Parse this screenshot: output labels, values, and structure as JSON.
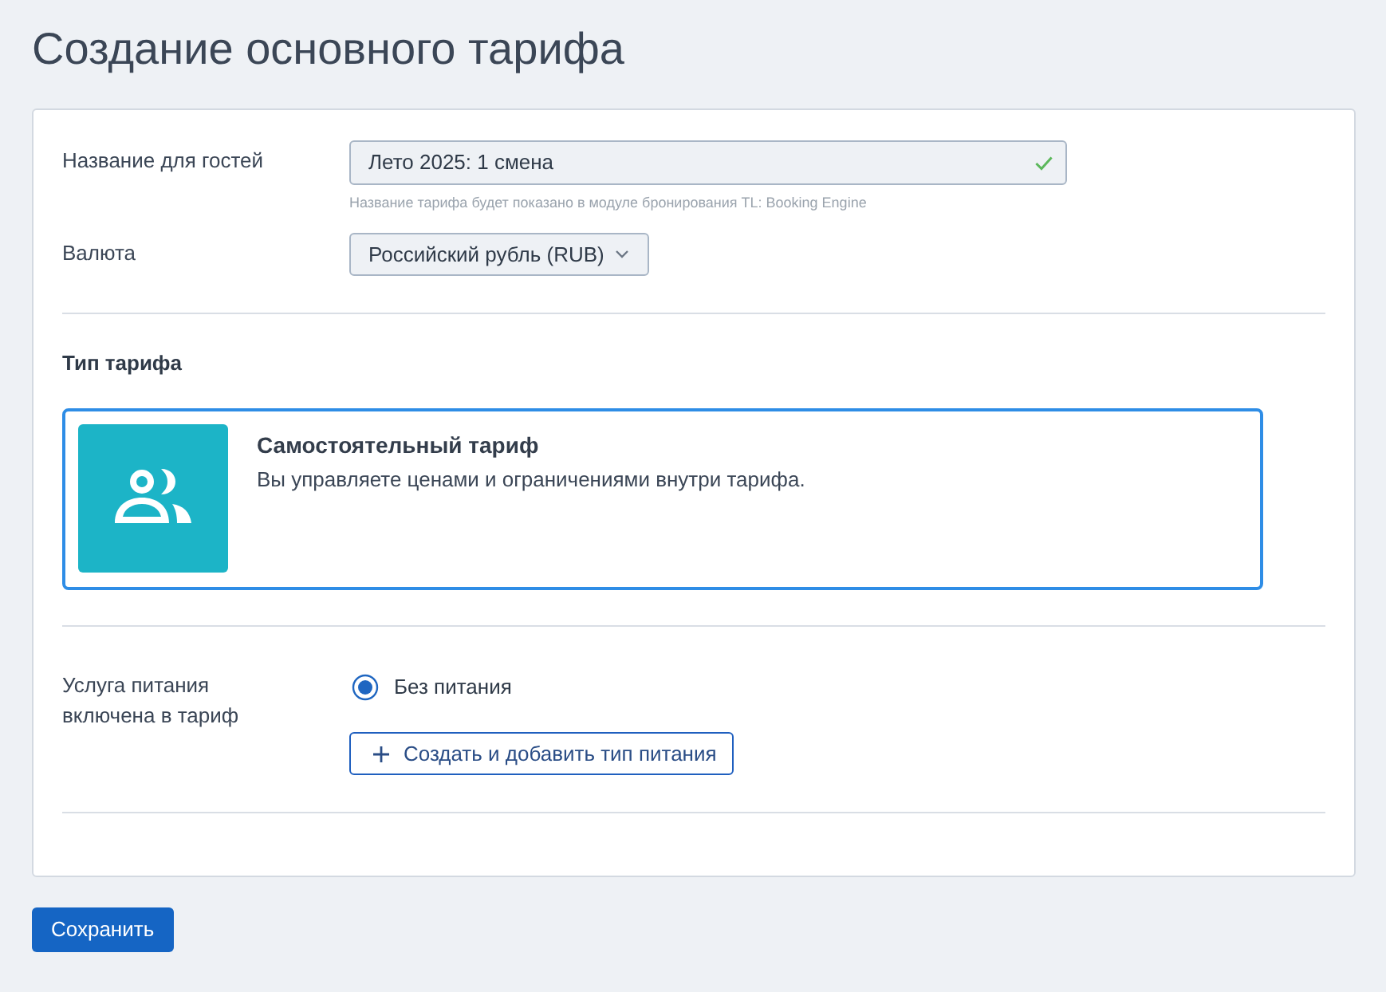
{
  "page": {
    "title": "Создание основного тарифа"
  },
  "form": {
    "guest_name": {
      "label": "Название для гостей",
      "value": "Лето 2025: 1 смена",
      "valid": true,
      "hint": "Название тарифа будет показано в модуле бронирования TL: Booking Engine"
    },
    "currency": {
      "label": "Валюта",
      "value": "Российский рубль (RUB)"
    },
    "tariff_type": {
      "heading": "Тип тарифа",
      "options": [
        {
          "title": "Самостоятельный тариф",
          "description": "Вы управляете ценами и ограничениями внутри тарифа.",
          "selected": true
        }
      ]
    },
    "meals": {
      "label": "Услуга питания включена в тариф",
      "options": [
        {
          "label": "Без питания",
          "selected": true
        }
      ],
      "add_button": "Создать и добавить тип питания"
    }
  },
  "save_button": "Сохранить"
}
